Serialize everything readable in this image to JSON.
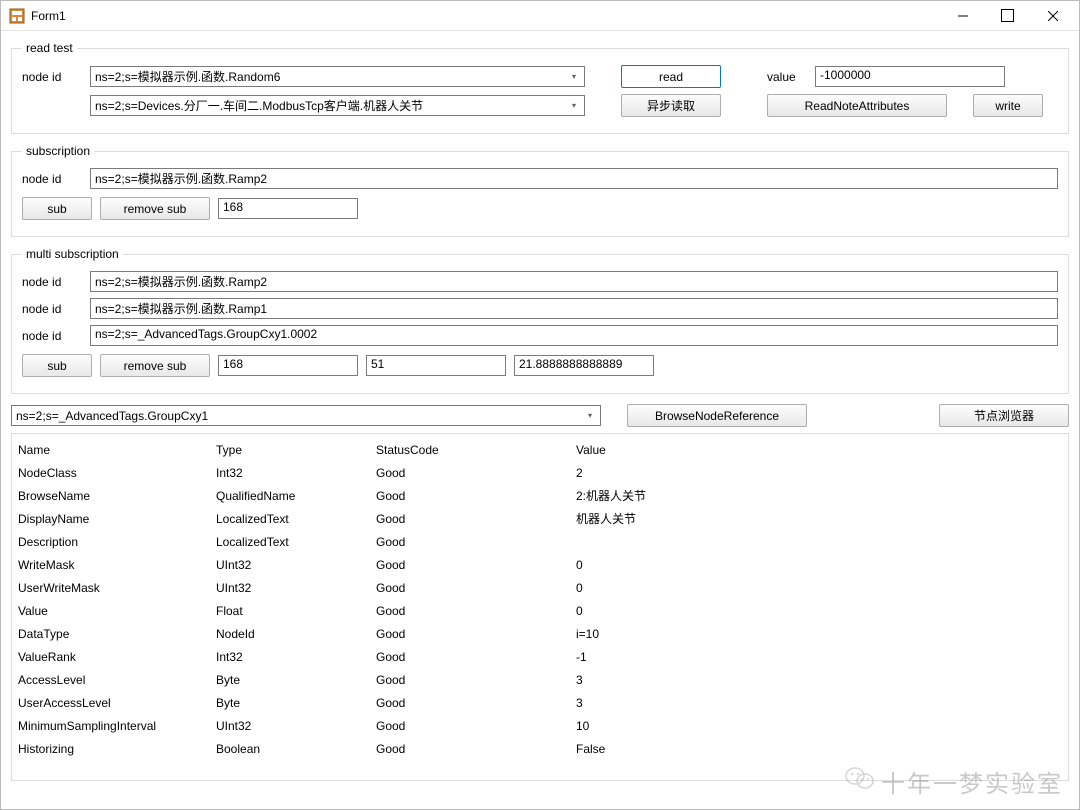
{
  "window": {
    "title": "Form1"
  },
  "readtest": {
    "legend": "read test",
    "nodeid_label": "node id",
    "nodeid_value": "ns=2;s=模拟器示例.函数.Random6",
    "second_combo": "ns=2;s=Devices.分厂一.车间二.ModbusTcp客户端.机器人关节",
    "read_btn": "read",
    "async_btn": "异步读取",
    "value_label": "value",
    "value": "-1000000",
    "readattrs_btn": "ReadNoteAttributes",
    "write_btn": "write"
  },
  "subscription": {
    "legend": "subscription",
    "nodeid_label": "node id",
    "nodeid_value": "ns=2;s=模拟器示例.函数.Ramp2",
    "sub_btn": "sub",
    "remove_btn": "remove sub",
    "val": "168"
  },
  "multisub": {
    "legend": "multi subscription",
    "nodeid_label": "node id",
    "id1": "ns=2;s=模拟器示例.函数.Ramp2",
    "id2": "ns=2;s=模拟器示例.函数.Ramp1",
    "id3": "ns=2;s=_AdvancedTags.GroupCxy1.0002",
    "sub_btn": "sub",
    "remove_btn": "remove sub",
    "v1": "168",
    "v2": "51",
    "v3": "21.8888888888889"
  },
  "browse": {
    "combo": "ns=2;s=_AdvancedTags.GroupCxy1",
    "browse_btn": "BrowseNodeReference",
    "browser_btn": "节点浏览器"
  },
  "grid": {
    "header": {
      "c1": "Name",
      "c2": "Type",
      "c3": "StatusCode",
      "c4": "Value"
    },
    "rows": [
      {
        "c1": "NodeClass",
        "c2": "Int32",
        "c3": "Good",
        "c4": "2"
      },
      {
        "c1": "BrowseName",
        "c2": "QualifiedName",
        "c3": "Good",
        "c4": "2:机器人关节"
      },
      {
        "c1": "DisplayName",
        "c2": "LocalizedText",
        "c3": "Good",
        "c4": "机器人关节"
      },
      {
        "c1": "Description",
        "c2": "LocalizedText",
        "c3": "Good",
        "c4": ""
      },
      {
        "c1": "WriteMask",
        "c2": "UInt32",
        "c3": "Good",
        "c4": "0"
      },
      {
        "c1": "UserWriteMask",
        "c2": "UInt32",
        "c3": "Good",
        "c4": "0"
      },
      {
        "c1": "Value",
        "c2": "Float",
        "c3": "Good",
        "c4": "0"
      },
      {
        "c1": "DataType",
        "c2": "NodeId",
        "c3": "Good",
        "c4": "i=10"
      },
      {
        "c1": "ValueRank",
        "c2": "Int32",
        "c3": "Good",
        "c4": "-1"
      },
      {
        "c1": "AccessLevel",
        "c2": "Byte",
        "c3": "Good",
        "c4": "3"
      },
      {
        "c1": "UserAccessLevel",
        "c2": "Byte",
        "c3": "Good",
        "c4": "3"
      },
      {
        "c1": "MinimumSamplingInterval",
        "c2": "UInt32",
        "c3": "Good",
        "c4": "10"
      },
      {
        "c1": "Historizing",
        "c2": "Boolean",
        "c3": "Good",
        "c4": "False"
      }
    ]
  },
  "watermark": "十年一梦实验室"
}
